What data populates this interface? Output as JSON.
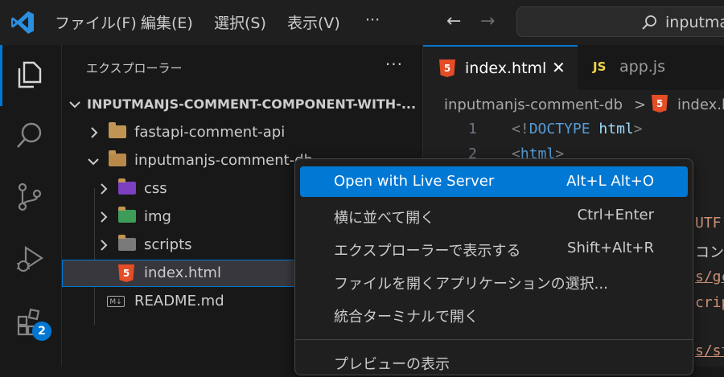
{
  "menubar": {
    "items": [
      "ファイル(F)",
      "編集(E)",
      "選択(S)",
      "表示(V)"
    ],
    "more": "···",
    "back": "←",
    "forward": "→",
    "search_text": "inputman"
  },
  "activity_bar": {
    "extensions_badge": "2"
  },
  "explorer": {
    "title": "エクスプローラー",
    "more": "···",
    "root": "INPUTMANJS-COMMENT-COMPONENT-WITH-...",
    "items": [
      {
        "label": "fastapi-comment-api",
        "icon": "folder-icon"
      },
      {
        "label": "inputmanjs-comment-db",
        "icon": "folder-open-icon"
      },
      {
        "label": "css",
        "icon": "css-folder-icon"
      },
      {
        "label": "img",
        "icon": "image-folder-icon"
      },
      {
        "label": "scripts",
        "icon": "scripts-folder-icon"
      },
      {
        "label": "index.html",
        "icon": "html5-icon"
      },
      {
        "label": "README.md",
        "icon": "markdown-icon"
      }
    ],
    "selected": "index.html"
  },
  "editor": {
    "tabs": [
      {
        "label": "index.html",
        "active": true,
        "icon": "html5-icon"
      },
      {
        "label": "app.js",
        "active": false,
        "icon": "js-icon"
      }
    ],
    "js_icon_text": "JS",
    "html_icon_text": "5",
    "breadcrumb": [
      "inputmanjs-comment-db",
      ">",
      "index.h"
    ],
    "lines": [
      {
        "n": "1",
        "parts": [
          "<!",
          "DOCTYPE",
          " ",
          "html",
          ">"
        ]
      },
      {
        "n": "2",
        "parts": [
          "<",
          "html",
          ">"
        ]
      }
    ],
    "peek": [
      "UTF",
      "コン",
      "s/gc",
      "crip",
      "s/st"
    ]
  },
  "context_menu": {
    "items": [
      {
        "label": "Open with Live Server",
        "shortcut": "Alt+L Alt+O"
      },
      {
        "label": "横に並べて開く",
        "shortcut": "Ctrl+Enter"
      },
      {
        "label": "エクスプローラーで表示する",
        "shortcut": "Shift+Alt+R"
      },
      {
        "label": "ファイルを開くアプリケーションの選択...",
        "shortcut": ""
      },
      {
        "label": "統合ターミナルで開く",
        "shortcut": ""
      },
      {
        "label": "プレビューの表示",
        "shortcut": ""
      }
    ]
  },
  "colors": {
    "accent": "#0078d4",
    "folder": "#c09553",
    "html5": "#e44d26",
    "js": "#f0d34b"
  }
}
